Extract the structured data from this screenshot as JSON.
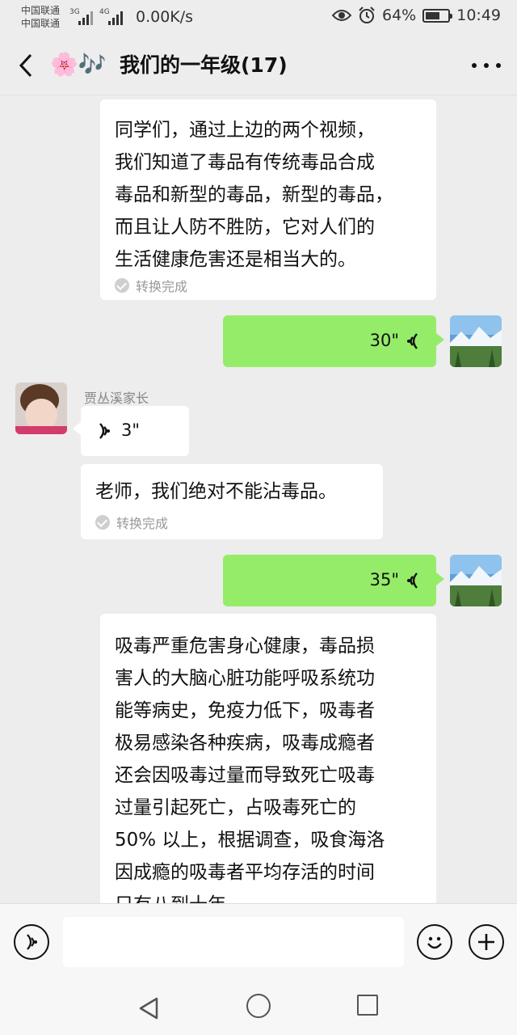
{
  "status_bar": {
    "carrier1": "中国联通",
    "carrier2": "中国联通",
    "net1": "3G",
    "net2": "4G",
    "speed": "0.00K/s",
    "battery": "64%",
    "battery_level": 0.64,
    "time": "10:49"
  },
  "header": {
    "emoji": "🌸🎶",
    "title": "我们的一年级(17)"
  },
  "messages": [
    {
      "side": "left",
      "type": "text",
      "text": "同学们，通过上边的两个视频，\n我们知道了毒品有传统毒品合成\n毒品和新型的毒品，新型的毒品，\n而且让人防不胜防，它对人们的\n生活健康危害还是相当大的。",
      "status": "转换完成"
    },
    {
      "side": "right",
      "type": "voice",
      "duration": "30\""
    },
    {
      "side": "left",
      "type": "voice",
      "sender": "贾丛溪家长",
      "duration": "3\""
    },
    {
      "side": "left",
      "type": "text",
      "text": "老师，我们绝对不能沾毒品。",
      "status": "转换完成"
    },
    {
      "side": "right",
      "type": "voice",
      "duration": "35\""
    },
    {
      "side": "left",
      "type": "text",
      "text": "吸毒严重危害身心健康，毒品损\n害人的大脑心脏功能呼吸系统功\n能等病史，免疫力低下，吸毒者\n极易感染各种疾病，吸毒成瘾者\n还会因吸毒过量而导致死亡吸毒\n过量引起死亡，占吸毒死亡的\n50% 以上，根据调查，吸食海洛\n因成瘾的吸毒者平均存活的时间\n只有八到十年。"
    }
  ]
}
